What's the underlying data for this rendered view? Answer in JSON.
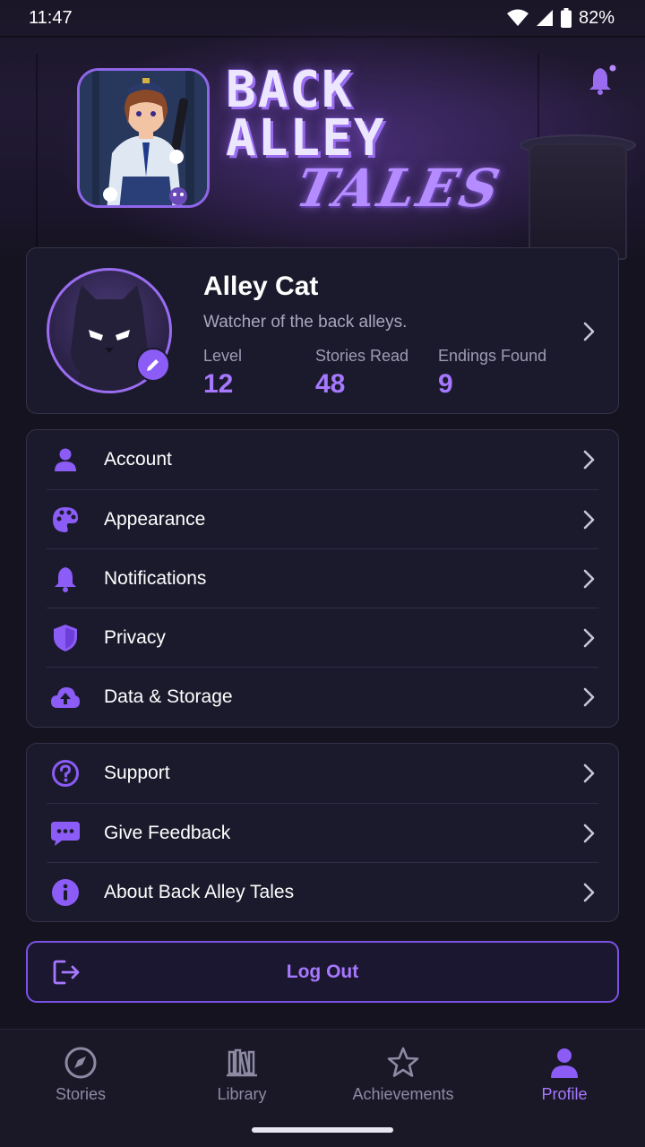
{
  "status_bar": {
    "time": "11:47",
    "battery": "82%"
  },
  "header": {
    "logo_line1": "BACK",
    "logo_line2": "ALLEY",
    "logo_line3": "TALES"
  },
  "profile": {
    "name": "Alley Cat",
    "bio": "Watcher of the back alleys.",
    "stats": [
      {
        "label": "Level",
        "value": "12"
      },
      {
        "label": "Stories Read",
        "value": "48"
      },
      {
        "label": "Endings Found",
        "value": "9"
      }
    ]
  },
  "settings_menu": [
    {
      "label": "Account",
      "icon": "person-icon"
    },
    {
      "label": "Appearance",
      "icon": "palette-icon"
    },
    {
      "label": "Notifications",
      "icon": "bell-icon"
    },
    {
      "label": "Privacy",
      "icon": "shield-icon"
    },
    {
      "label": "Data & Storage",
      "icon": "cloud-upload-icon"
    }
  ],
  "support_menu": [
    {
      "label": "Support",
      "icon": "help-circle-icon"
    },
    {
      "label": "Give Feedback",
      "icon": "chat-bubble-icon"
    },
    {
      "label": "About Back Alley Tales",
      "icon": "info-icon"
    }
  ],
  "logout": {
    "label": "Log Out"
  },
  "bottom_nav": [
    {
      "label": "Stories",
      "icon": "compass-icon",
      "active": false
    },
    {
      "label": "Library",
      "icon": "books-icon",
      "active": false
    },
    {
      "label": "Achievements",
      "icon": "star-icon",
      "active": false
    },
    {
      "label": "Profile",
      "icon": "person-icon",
      "active": true
    }
  ],
  "colors": {
    "accent": "#a678ff",
    "background": "#15131f",
    "card": "#1b1a2c"
  }
}
